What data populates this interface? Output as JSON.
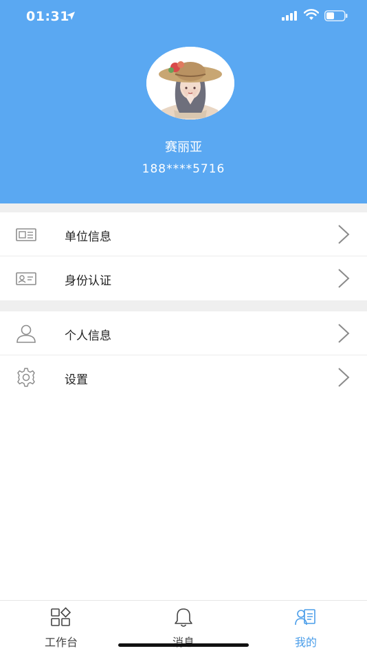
{
  "status_bar": {
    "time": "01:31"
  },
  "profile": {
    "name": "赛丽亚",
    "phone": "188****5716"
  },
  "menu_group_1": [
    {
      "label": "单位信息",
      "icon": "org-card-icon"
    },
    {
      "label": "身份认证",
      "icon": "id-card-icon"
    }
  ],
  "menu_group_2": [
    {
      "label": "个人信息",
      "icon": "person-icon"
    },
    {
      "label": "设置",
      "icon": "gear-icon"
    }
  ],
  "tabbar": {
    "tabs": [
      {
        "label": "工作台",
        "icon": "grid-icon",
        "active": false
      },
      {
        "label": "消息",
        "icon": "bell-icon",
        "active": false
      },
      {
        "label": "我的",
        "icon": "profile-card-icon",
        "active": true
      }
    ]
  },
  "colors": {
    "header": "#5aa8f2",
    "accent": "#4a9de9",
    "section_gap": "#efefef"
  }
}
